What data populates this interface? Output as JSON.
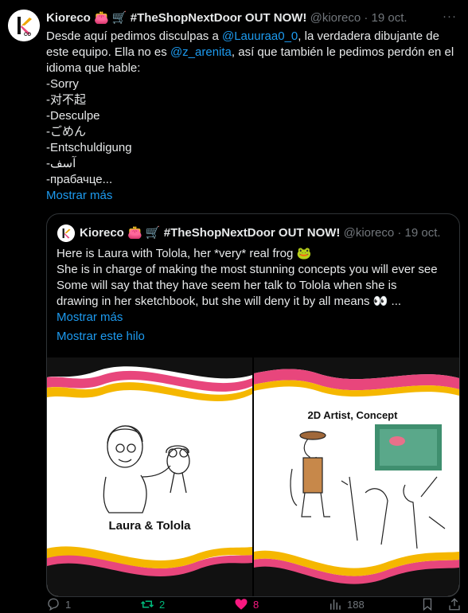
{
  "tweet": {
    "author_name": "Kioreco",
    "emoji_bag": "👛",
    "emoji_cart": "🛒",
    "headline": "#TheShopNextDoor OUT NOW!",
    "handle": "@kioreco",
    "dot": "·",
    "date": "19 oct.",
    "more": "···",
    "text_line1_pre": "Desde aquí pedimos disculpas a ",
    "mention1": "@Lauuraa0_0",
    "text_line1_post": ", la verdadera dibujante de",
    "text_line2": "este equipo. Ella no es ",
    "mention2": "@z_arenita",
    "text_line2_post": ", así que también le pedimos perdón en el",
    "text_line3": "idioma que hable:",
    "apologies": [
      "-Sorry",
      "-对不起",
      "-Desculpe",
      "-ごめん",
      "-Entschuldigung",
      "-آسف",
      "-прабачце..."
    ],
    "show_more": "Mostrar más"
  },
  "quote": {
    "author_name": "Kioreco",
    "emoji_bag": "👛",
    "emoji_cart": "🛒",
    "headline": "#TheShopNextDoor OUT NOW!",
    "handle": "@kioreco",
    "dot": "·",
    "date": "19 oct.",
    "line1": "Here is Laura with Tolola, her *very* real frog 🐸",
    "line2": "She is in charge of making the most stunning concepts you will ever see",
    "line3": "Some will say that they have seem her talk to Tolola when she is",
    "line4": "drawing in her sketchbook, but she will deny it by all means 👀 ...",
    "show_more": "Mostrar más",
    "show_thread": "Mostrar este hilo",
    "image1_caption": "Laura & Tolola",
    "image2_caption": "2D Artist, Concept"
  },
  "actions": {
    "replies": "1",
    "retweets": "2",
    "likes": "8",
    "views": "188"
  },
  "colors": {
    "link": "#1d9bf0",
    "retweet": "#00ba7c",
    "like": "#f91880",
    "muted": "#71767b"
  }
}
